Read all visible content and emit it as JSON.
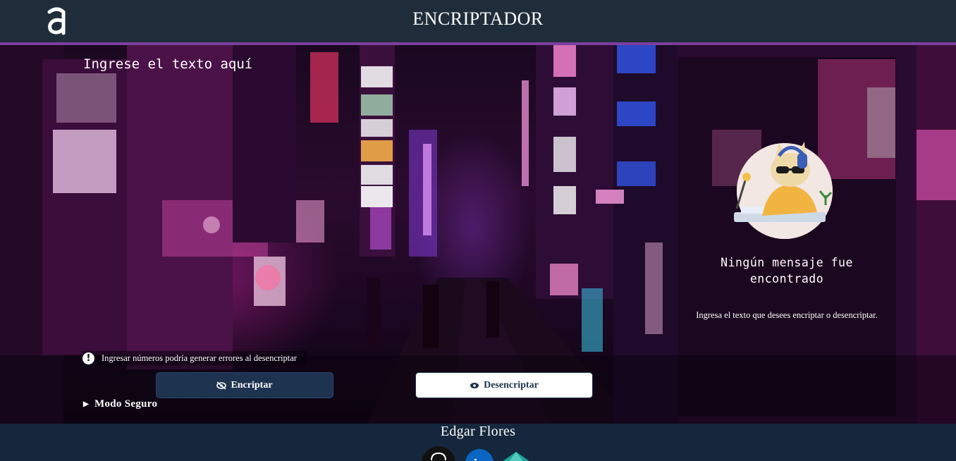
{
  "header": {
    "logo_icon": "alura-logo-icon",
    "title": "ENCRIPTADOR"
  },
  "input": {
    "placeholder": "Ingrese el texto aquí",
    "value": ""
  },
  "warning": {
    "icon": "exclamation-circle-icon",
    "text": "Ingresar números podría generar errores al desencriptar"
  },
  "buttons": {
    "encrypt": {
      "icon": "eye-slash-icon",
      "label": "Encriptar"
    },
    "decrypt": {
      "icon": "eye-icon",
      "label": "Desencriptar"
    }
  },
  "safe_mode": {
    "icon": "caret-right-icon",
    "label": "Modo Seguro"
  },
  "output": {
    "illustration": "cat-with-headphones-illustration",
    "title": "Ningún mensaje fue encontrado",
    "description": "Ingresa el texto que desees encriptar o desencriptar."
  },
  "footer": {
    "author": "Edgar Flores",
    "links": [
      "github-icon",
      "linkedin-icon",
      "portfolio-icon"
    ]
  },
  "colors": {
    "header_bg": "#1f2d3b",
    "accent_border": "#7b3f9e",
    "button_dark": "#1e3350",
    "button_light": "#ffffff",
    "footer_bg": "#162a40"
  }
}
